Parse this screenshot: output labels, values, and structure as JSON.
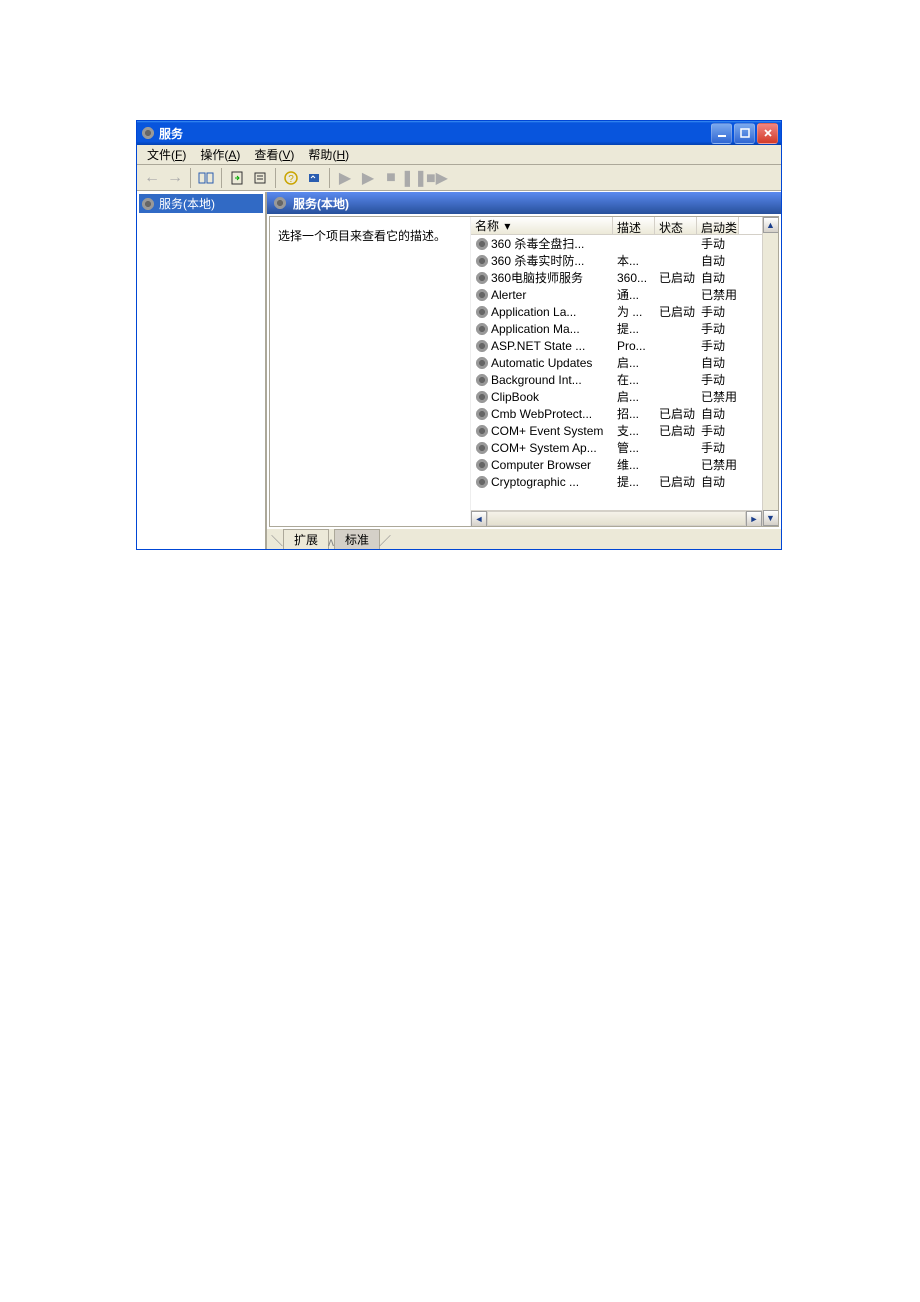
{
  "window": {
    "title": "服务"
  },
  "menus": {
    "file": {
      "text": "文件",
      "key": "F"
    },
    "action": {
      "text": "操作",
      "key": "A"
    },
    "view": {
      "text": "查看",
      "key": "V"
    },
    "help": {
      "text": "帮助",
      "key": "H"
    }
  },
  "tree": {
    "root": "服务(本地)"
  },
  "panel": {
    "title": "服务(本地)",
    "hint": "选择一个项目来查看它的描述。"
  },
  "columns": {
    "name": "名称",
    "desc": "描述",
    "status": "状态",
    "start": "启动类"
  },
  "tabs": {
    "extended": "扩展",
    "standard": "标准"
  },
  "services": [
    {
      "name": "360 杀毒全盘扫...",
      "desc": "",
      "status": "",
      "start": "手动"
    },
    {
      "name": "360 杀毒实时防...",
      "desc": "本...",
      "status": "",
      "start": "自动"
    },
    {
      "name": "360电脑技师服务",
      "desc": "360...",
      "status": "已启动",
      "start": "自动"
    },
    {
      "name": "Alerter",
      "desc": "通...",
      "status": "",
      "start": "已禁用"
    },
    {
      "name": "Application La...",
      "desc": "为 ...",
      "status": "已启动",
      "start": "手动"
    },
    {
      "name": "Application Ma...",
      "desc": "提...",
      "status": "",
      "start": "手动"
    },
    {
      "name": "ASP.NET State ...",
      "desc": "Pro...",
      "status": "",
      "start": "手动"
    },
    {
      "name": "Automatic Updates",
      "desc": "启...",
      "status": "",
      "start": "自动"
    },
    {
      "name": "Background Int...",
      "desc": "在...",
      "status": "",
      "start": "手动"
    },
    {
      "name": "ClipBook",
      "desc": "启...",
      "status": "",
      "start": "已禁用"
    },
    {
      "name": "Cmb WebProtect...",
      "desc": "招...",
      "status": "已启动",
      "start": "自动"
    },
    {
      "name": "COM+ Event System",
      "desc": "支...",
      "status": "已启动",
      "start": "手动"
    },
    {
      "name": "COM+ System Ap...",
      "desc": "管...",
      "status": "",
      "start": "手动"
    },
    {
      "name": "Computer Browser",
      "desc": "维...",
      "status": "",
      "start": "已禁用"
    },
    {
      "name": "Cryptographic ...",
      "desc": "提...",
      "status": "已启动",
      "start": "自动"
    }
  ]
}
